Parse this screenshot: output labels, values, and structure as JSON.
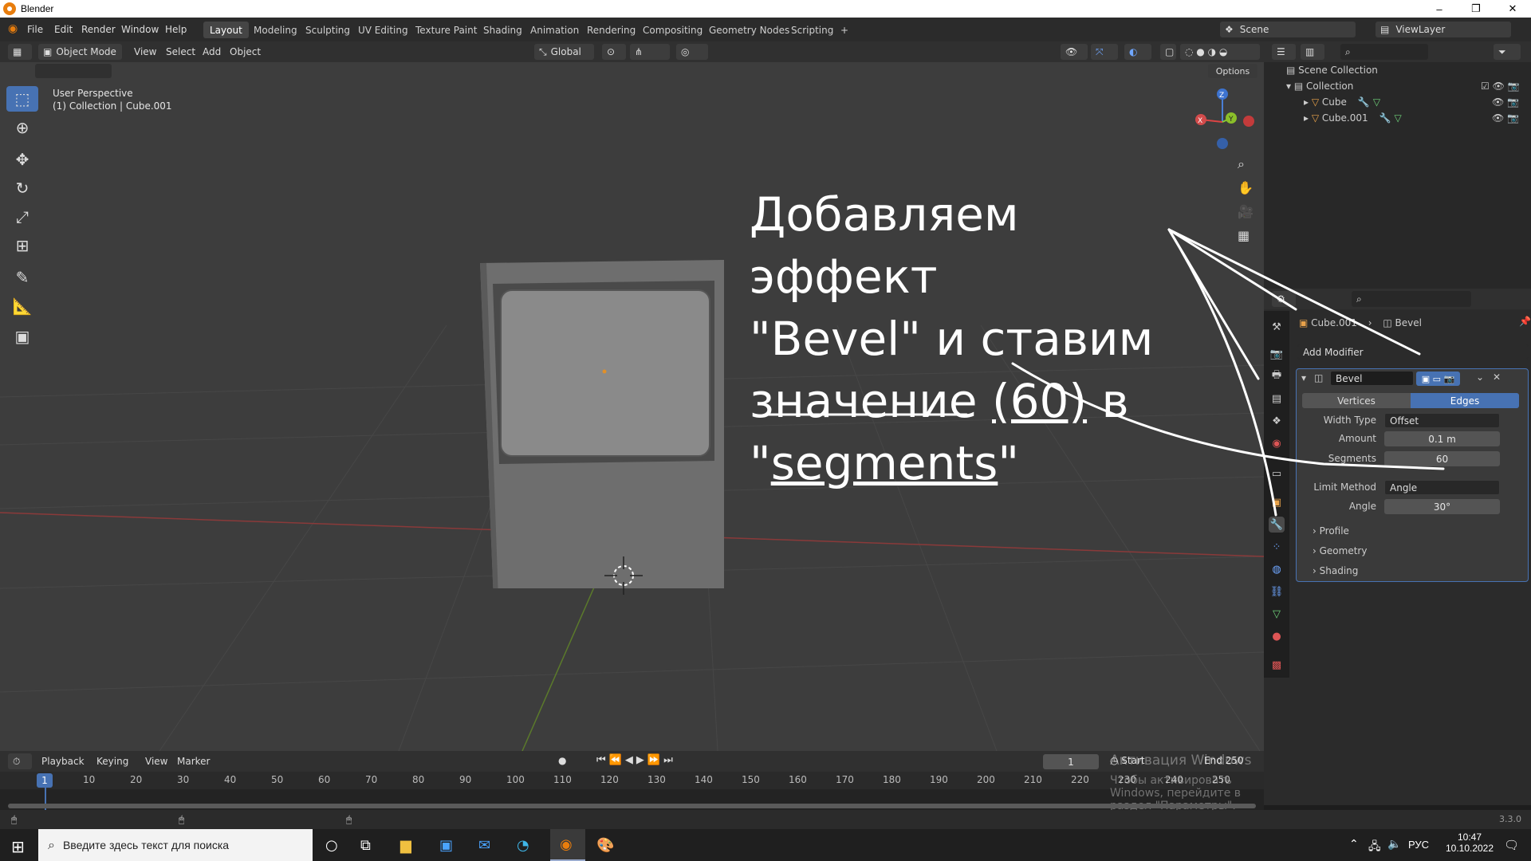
{
  "window": {
    "title": "Blender",
    "minimize": "–",
    "restore": "❐",
    "close": "✕"
  },
  "menu": [
    "File",
    "Edit",
    "Render",
    "Window",
    "Help"
  ],
  "workspaces": [
    "Layout",
    "Modeling",
    "Sculpting",
    "UV Editing",
    "Texture Paint",
    "Shading",
    "Animation",
    "Rendering",
    "Compositing",
    "Geometry Nodes",
    "Scripting",
    "+"
  ],
  "scene": {
    "label": "Scene",
    "view_layer": "ViewLayer"
  },
  "viewport": {
    "mode": "Object Mode",
    "menus": [
      "View",
      "Select",
      "Add",
      "Object"
    ],
    "transform": "Global",
    "options": "Options",
    "overlay_title": "User Perspective",
    "overlay_sub": "(1) Collection | Cube.001",
    "gizmo": {
      "z": "Z",
      "y": "Y",
      "x": "X"
    }
  },
  "annotation": {
    "line1": "Добавляем эффект",
    "line2": "\"Bevel\" и ставим",
    "line3a": "значение ",
    "line3b": "(60)",
    "line3c": " в",
    "line4a": "\"",
    "line4b": "segments",
    "line4c": "\""
  },
  "outliner": {
    "root": "Scene Collection",
    "collection": "Collection",
    "items": [
      "Cube",
      "Cube.001"
    ]
  },
  "properties": {
    "breadcrumb_obj": "Cube.001",
    "breadcrumb_mod": "Bevel",
    "add_modifier": "Add Modifier",
    "modifier_name": "Bevel",
    "tabs": [
      "Vertices",
      "Edges"
    ],
    "fields": [
      {
        "label": "Width Type",
        "value": "Offset"
      },
      {
        "label": "Amount",
        "value": "0.1 m"
      },
      {
        "label": "Segments",
        "value": "60"
      },
      {
        "label": "Limit Method",
        "value": "Angle"
      },
      {
        "label": "Angle",
        "value": "30°"
      }
    ],
    "sections": [
      "Profile",
      "Geometry",
      "Shading"
    ]
  },
  "timeline": {
    "menus": [
      "Playback",
      "Keying",
      "View",
      "Marker"
    ],
    "current_frame": "1",
    "start_label": "Start",
    "end_label": "End",
    "end_value": "250",
    "ticks": [
      "10",
      "20",
      "30",
      "40",
      "50",
      "60",
      "70",
      "80",
      "90",
      "100",
      "110",
      "120",
      "130",
      "140",
      "150",
      "160",
      "170",
      "180",
      "190",
      "200",
      "210",
      "220",
      "230",
      "240",
      "250"
    ],
    "frame_marker": "1",
    "activation_title": "Активация Windows",
    "activation_sub": "Чтобы активировать Windows, перейдите в раздел \"Параметры\"."
  },
  "status": {
    "version": "3.3.0"
  },
  "taskbar": {
    "search_placeholder": "Введите здесь текст для поиска",
    "lang": "РУС",
    "time": "10:47",
    "date": "10.10.2022"
  },
  "colors": {
    "accent": "#4772b3",
    "orange": "#e87d0d"
  }
}
